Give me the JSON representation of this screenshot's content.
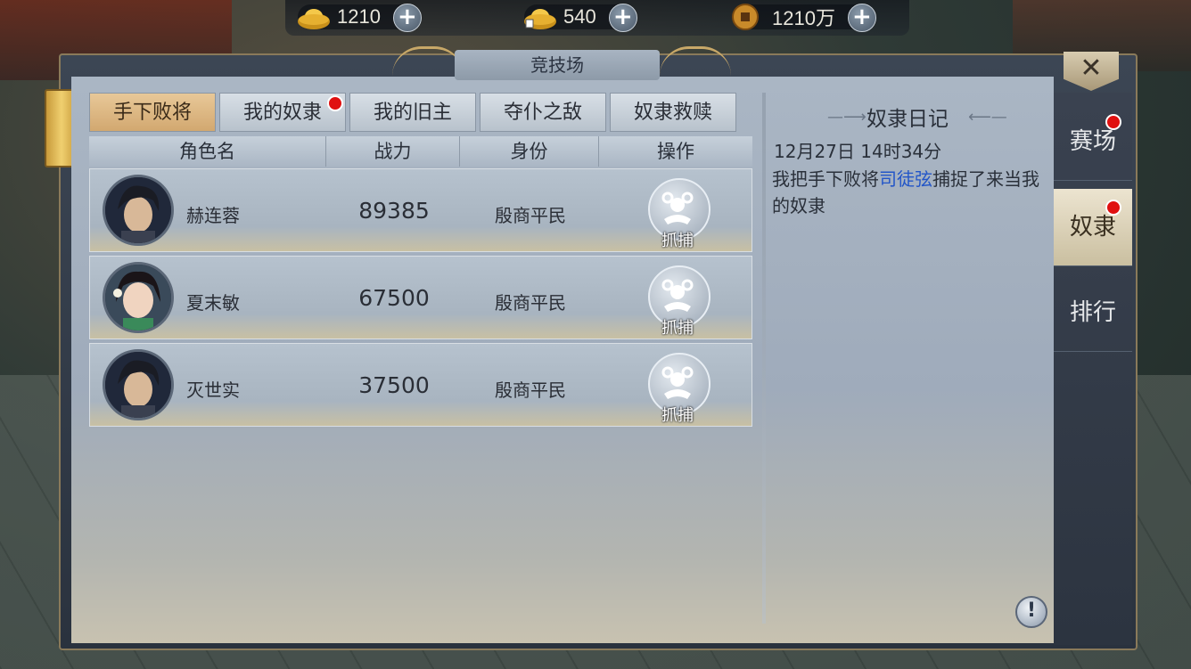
{
  "currencies": [
    {
      "icon": "gold-ingot-icon",
      "value": "1210"
    },
    {
      "icon": "gold-ingot-bound-icon",
      "value": "540"
    },
    {
      "icon": "copper-coin-icon",
      "value": "1210万"
    }
  ],
  "window": {
    "title": "竞技场",
    "close_label": "✕"
  },
  "tabs": [
    {
      "label": "手下败将",
      "active": true,
      "badge": false
    },
    {
      "label": "我的奴隶",
      "active": false,
      "badge": true
    },
    {
      "label": "我的旧主",
      "active": false,
      "badge": false
    },
    {
      "label": "夺仆之敌",
      "active": false,
      "badge": false
    },
    {
      "label": "奴隶救赎",
      "active": false,
      "badge": false
    }
  ],
  "table": {
    "headers": [
      "角色名",
      "战力",
      "身份",
      "操作"
    ],
    "rows": [
      {
        "name": "赫连蓉",
        "power": "89385",
        "rank": "殷商平民",
        "action": "抓捕",
        "avatar": "male"
      },
      {
        "name": "夏末敏",
        "power": "67500",
        "rank": "殷商平民",
        "action": "抓捕",
        "avatar": "female"
      },
      {
        "name": "灭世实",
        "power": "37500",
        "rank": "殷商平民",
        "action": "抓捕",
        "avatar": "male"
      }
    ]
  },
  "diary": {
    "title": "奴隶日记",
    "time": "12月27日  14时34分",
    "text_before": "我把手下败将",
    "highlight": "司徒弦",
    "text_after": "捕捉了来当我的奴隶"
  },
  "side_nav": [
    {
      "label": "赛场",
      "active": false,
      "badge": true
    },
    {
      "label": "奴隶",
      "active": true,
      "badge": true
    },
    {
      "label": "排行",
      "active": false,
      "badge": false
    }
  ],
  "info_label": "!"
}
